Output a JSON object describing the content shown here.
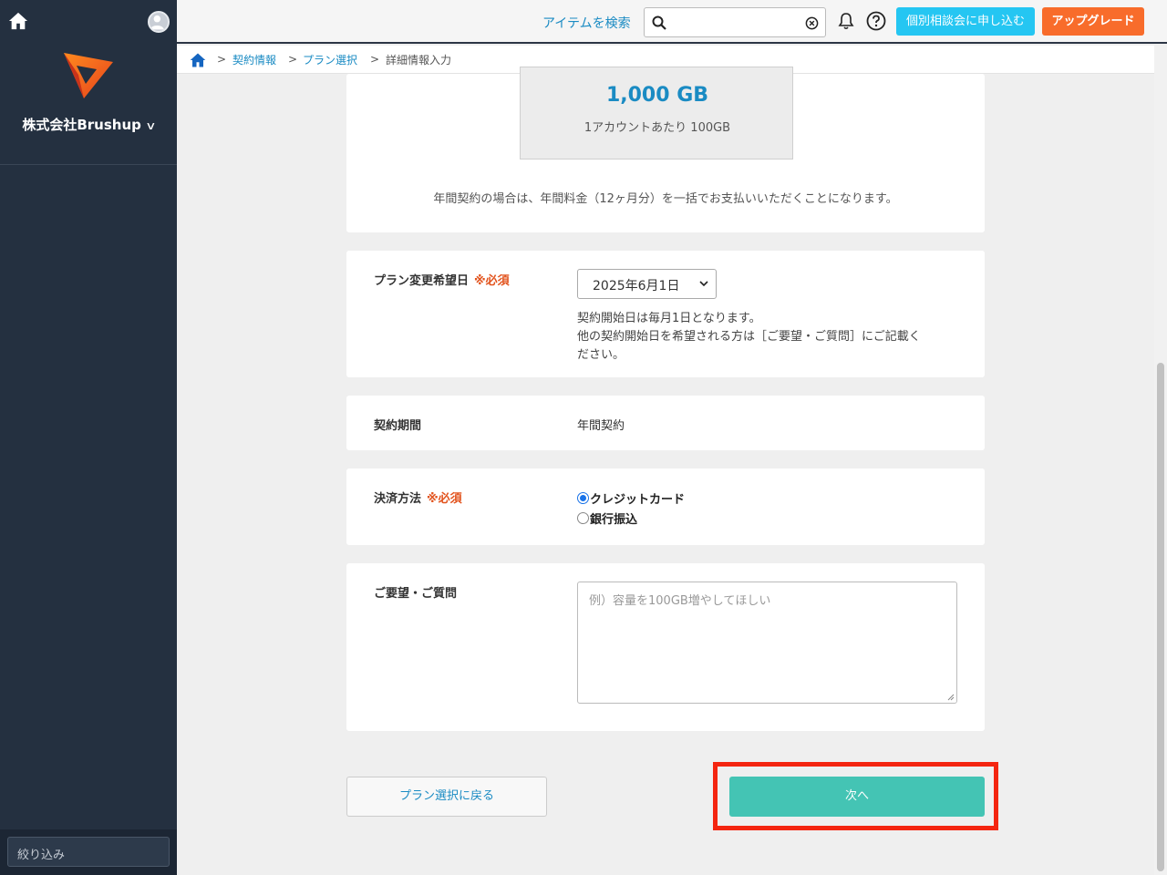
{
  "sidebar": {
    "company": "株式会社Brushup",
    "filter_label": "絞り込み"
  },
  "header": {
    "search_link": "アイテムを検索",
    "search_value": "",
    "consult_button": "個別相談会に申し込む",
    "upgrade_button": "アップグレード"
  },
  "breadcrumb": {
    "sep": ">",
    "items": [
      "契約情報",
      "プラン選択",
      "詳細情報入力"
    ]
  },
  "storage": {
    "total": "1,000 GB",
    "per_account": "1アカウントあたり 100GB",
    "annual_note": "年間契約の場合は、年間料金（12ヶ月分）を一括でお支払いいただくことになります。"
  },
  "form": {
    "required_mark": "※必須",
    "change_date": {
      "label": "プラン変更希望日",
      "value": "2025年6月1日",
      "note_lines": [
        "契約開始日は毎月1日となります。",
        "他の契約開始日を希望される方は［ご要望・ご質問］にご記載く",
        "ださい。"
      ]
    },
    "period": {
      "label": "契約期間",
      "value": "年間契約"
    },
    "payment": {
      "label": "決済方法",
      "options": [
        "クレジットカード",
        "銀行振込"
      ],
      "selected": "クレジットカード"
    },
    "requests": {
      "label": "ご要望・ご質問",
      "placeholder": "例）容量を100GB増やしてほしい"
    }
  },
  "buttons": {
    "back": "プラン選択に戻る",
    "next": "次へ"
  },
  "colors": {
    "accent_blue": "#1a8bc3",
    "required_red": "#e2531d",
    "next_teal": "#44c4b4",
    "upgrade_orange": "#f86c2b",
    "consult_cyan": "#25c6f2",
    "highlight_frame": "#f42510",
    "sidebar_bg": "#243040"
  }
}
